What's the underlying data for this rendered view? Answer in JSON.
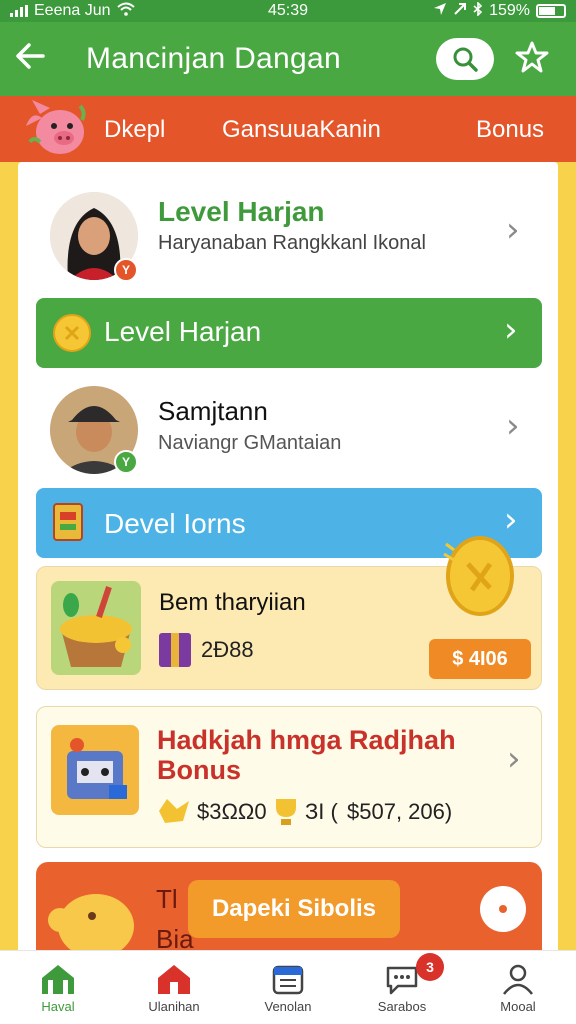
{
  "status_bar": {
    "carrier": "Eeena Jun",
    "time": "45:39",
    "battery": "159%"
  },
  "app_bar": {
    "title": "Mancinjan Dangan",
    "icons": [
      "back-arrow-icon",
      "search-icon",
      "star-icon"
    ]
  },
  "tabs": [
    "Dkepl",
    "GansuuaKanin",
    "Bonus"
  ],
  "list": {
    "profile_1": {
      "title": "Level Harjan",
      "subtitle": "Haryanaban Rangkkanl Ikonal",
      "badge": "Y"
    },
    "green_bar": {
      "label": "Level Harjan"
    },
    "profile_2": {
      "title": "Samjtann",
      "subtitle": "Naviangr GMantaian",
      "badge": "Y"
    },
    "blue_bar": {
      "label": "Devel Iorns"
    },
    "reward_card_1": {
      "title": "Bem tharyiian",
      "amount": "2Ð88",
      "button": "$ 4I06"
    },
    "reward_card_2": {
      "title": "Hadkjah hmga Radjhah Bonus",
      "value_1": "$3ΩΩ0",
      "value_2": "$507, 206)",
      "value_2_prefix": "ЗI ("
    },
    "promo": {
      "text_top": "Tl",
      "text_bottom": "Bia",
      "button": "Dapeki Sibolis"
    }
  },
  "bottom_nav": {
    "items": [
      "Haval",
      "Ulanihan",
      "Venolan",
      "Sarabos",
      "Mooal"
    ],
    "notification_count": "3"
  },
  "colors": {
    "green": "#4aa843",
    "orange": "#e4562a",
    "blue": "#4db3e6",
    "yellow_bg": "#f7d24a",
    "button_orange": "#f08a24"
  }
}
